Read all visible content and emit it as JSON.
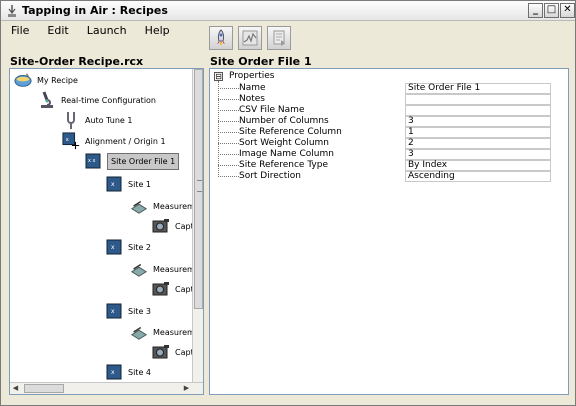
{
  "window": {
    "title": "Tapping in Air : Recipes",
    "min": "_",
    "max": "□",
    "close": "✕"
  },
  "menu": [
    "File",
    "Edit",
    "Launch",
    "Help"
  ],
  "toolbar": {
    "buttons": [
      "launch-icon",
      "chart-icon",
      "export-icon"
    ]
  },
  "left_panel": {
    "title": "Site-Order Recipe.rcx",
    "tree": [
      {
        "label": "My Recipe",
        "icon": "recipe-bowl-icon"
      },
      {
        "label": "Real-time Configuration",
        "icon": "microscope-icon"
      },
      {
        "label": "Auto Tune 1",
        "icon": "tuning-fork-icon"
      },
      {
        "label": "Alignment / Origin 1",
        "icon": "alignment-icon"
      },
      {
        "label": "Site Order File 1",
        "icon": "site-order-icon",
        "selected": true
      },
      {
        "label": "Site 1",
        "icon": "site-icon"
      },
      {
        "label": "Measuremen",
        "icon": "measurement-icon"
      },
      {
        "label": "Capt",
        "icon": "camera-icon"
      },
      {
        "label": "Site 2",
        "icon": "site-icon"
      },
      {
        "label": "Measuremen",
        "icon": "measurement-icon"
      },
      {
        "label": "Capt",
        "icon": "camera-icon"
      },
      {
        "label": "Site 3",
        "icon": "site-icon"
      },
      {
        "label": "Measuremen",
        "icon": "measurement-icon"
      },
      {
        "label": "Capt",
        "icon": "camera-icon"
      },
      {
        "label": "Site 4",
        "icon": "site-icon"
      }
    ]
  },
  "right_panel": {
    "title": "Site Order File 1",
    "group": {
      "label": "Properties",
      "expander": "⊟"
    },
    "properties": [
      {
        "name": "Name",
        "value": "Site Order File 1"
      },
      {
        "name": "Notes",
        "value": ""
      },
      {
        "name": "CSV File Name",
        "value": ""
      },
      {
        "name": "Number of Columns",
        "value": "3"
      },
      {
        "name": "Site Reference Column",
        "value": "1"
      },
      {
        "name": "Sort Weight Column",
        "value": "2"
      },
      {
        "name": "Image Name Column",
        "value": "3"
      },
      {
        "name": "Site Reference Type",
        "value": "By Index"
      },
      {
        "name": "Sort Direction",
        "value": "Ascending"
      }
    ]
  },
  "scroll": {
    "left": "◀",
    "right": "▶"
  }
}
